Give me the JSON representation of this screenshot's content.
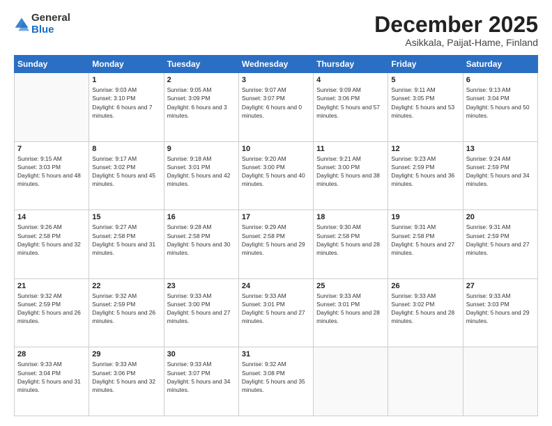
{
  "logo": {
    "general": "General",
    "blue": "Blue"
  },
  "header": {
    "month": "December 2025",
    "location": "Asikkala, Paijat-Hame, Finland"
  },
  "weekdays": [
    "Sunday",
    "Monday",
    "Tuesday",
    "Wednesday",
    "Thursday",
    "Friday",
    "Saturday"
  ],
  "weeks": [
    [
      {
        "day": "",
        "empty": true
      },
      {
        "day": "1",
        "sunrise": "Sunrise: 9:03 AM",
        "sunset": "Sunset: 3:10 PM",
        "daylight": "Daylight: 6 hours and 7 minutes."
      },
      {
        "day": "2",
        "sunrise": "Sunrise: 9:05 AM",
        "sunset": "Sunset: 3:09 PM",
        "daylight": "Daylight: 6 hours and 3 minutes."
      },
      {
        "day": "3",
        "sunrise": "Sunrise: 9:07 AM",
        "sunset": "Sunset: 3:07 PM",
        "daylight": "Daylight: 6 hours and 0 minutes."
      },
      {
        "day": "4",
        "sunrise": "Sunrise: 9:09 AM",
        "sunset": "Sunset: 3:06 PM",
        "daylight": "Daylight: 5 hours and 57 minutes."
      },
      {
        "day": "5",
        "sunrise": "Sunrise: 9:11 AM",
        "sunset": "Sunset: 3:05 PM",
        "daylight": "Daylight: 5 hours and 53 minutes."
      },
      {
        "day": "6",
        "sunrise": "Sunrise: 9:13 AM",
        "sunset": "Sunset: 3:04 PM",
        "daylight": "Daylight: 5 hours and 50 minutes."
      }
    ],
    [
      {
        "day": "7",
        "sunrise": "Sunrise: 9:15 AM",
        "sunset": "Sunset: 3:03 PM",
        "daylight": "Daylight: 5 hours and 48 minutes."
      },
      {
        "day": "8",
        "sunrise": "Sunrise: 9:17 AM",
        "sunset": "Sunset: 3:02 PM",
        "daylight": "Daylight: 5 hours and 45 minutes."
      },
      {
        "day": "9",
        "sunrise": "Sunrise: 9:18 AM",
        "sunset": "Sunset: 3:01 PM",
        "daylight": "Daylight: 5 hours and 42 minutes."
      },
      {
        "day": "10",
        "sunrise": "Sunrise: 9:20 AM",
        "sunset": "Sunset: 3:00 PM",
        "daylight": "Daylight: 5 hours and 40 minutes."
      },
      {
        "day": "11",
        "sunrise": "Sunrise: 9:21 AM",
        "sunset": "Sunset: 3:00 PM",
        "daylight": "Daylight: 5 hours and 38 minutes."
      },
      {
        "day": "12",
        "sunrise": "Sunrise: 9:23 AM",
        "sunset": "Sunset: 2:59 PM",
        "daylight": "Daylight: 5 hours and 36 minutes."
      },
      {
        "day": "13",
        "sunrise": "Sunrise: 9:24 AM",
        "sunset": "Sunset: 2:59 PM",
        "daylight": "Daylight: 5 hours and 34 minutes."
      }
    ],
    [
      {
        "day": "14",
        "sunrise": "Sunrise: 9:26 AM",
        "sunset": "Sunset: 2:58 PM",
        "daylight": "Daylight: 5 hours and 32 minutes."
      },
      {
        "day": "15",
        "sunrise": "Sunrise: 9:27 AM",
        "sunset": "Sunset: 2:58 PM",
        "daylight": "Daylight: 5 hours and 31 minutes."
      },
      {
        "day": "16",
        "sunrise": "Sunrise: 9:28 AM",
        "sunset": "Sunset: 2:58 PM",
        "daylight": "Daylight: 5 hours and 30 minutes."
      },
      {
        "day": "17",
        "sunrise": "Sunrise: 9:29 AM",
        "sunset": "Sunset: 2:58 PM",
        "daylight": "Daylight: 5 hours and 29 minutes."
      },
      {
        "day": "18",
        "sunrise": "Sunrise: 9:30 AM",
        "sunset": "Sunset: 2:58 PM",
        "daylight": "Daylight: 5 hours and 28 minutes."
      },
      {
        "day": "19",
        "sunrise": "Sunrise: 9:31 AM",
        "sunset": "Sunset: 2:58 PM",
        "daylight": "Daylight: 5 hours and 27 minutes."
      },
      {
        "day": "20",
        "sunrise": "Sunrise: 9:31 AM",
        "sunset": "Sunset: 2:59 PM",
        "daylight": "Daylight: 5 hours and 27 minutes."
      }
    ],
    [
      {
        "day": "21",
        "sunrise": "Sunrise: 9:32 AM",
        "sunset": "Sunset: 2:59 PM",
        "daylight": "Daylight: 5 hours and 26 minutes."
      },
      {
        "day": "22",
        "sunrise": "Sunrise: 9:32 AM",
        "sunset": "Sunset: 2:59 PM",
        "daylight": "Daylight: 5 hours and 26 minutes."
      },
      {
        "day": "23",
        "sunrise": "Sunrise: 9:33 AM",
        "sunset": "Sunset: 3:00 PM",
        "daylight": "Daylight: 5 hours and 27 minutes."
      },
      {
        "day": "24",
        "sunrise": "Sunrise: 9:33 AM",
        "sunset": "Sunset: 3:01 PM",
        "daylight": "Daylight: 5 hours and 27 minutes."
      },
      {
        "day": "25",
        "sunrise": "Sunrise: 9:33 AM",
        "sunset": "Sunset: 3:01 PM",
        "daylight": "Daylight: 5 hours and 28 minutes."
      },
      {
        "day": "26",
        "sunrise": "Sunrise: 9:33 AM",
        "sunset": "Sunset: 3:02 PM",
        "daylight": "Daylight: 5 hours and 28 minutes."
      },
      {
        "day": "27",
        "sunrise": "Sunrise: 9:33 AM",
        "sunset": "Sunset: 3:03 PM",
        "daylight": "Daylight: 5 hours and 29 minutes."
      }
    ],
    [
      {
        "day": "28",
        "sunrise": "Sunrise: 9:33 AM",
        "sunset": "Sunset: 3:04 PM",
        "daylight": "Daylight: 5 hours and 31 minutes."
      },
      {
        "day": "29",
        "sunrise": "Sunrise: 9:33 AM",
        "sunset": "Sunset: 3:06 PM",
        "daylight": "Daylight: 5 hours and 32 minutes."
      },
      {
        "day": "30",
        "sunrise": "Sunrise: 9:33 AM",
        "sunset": "Sunset: 3:07 PM",
        "daylight": "Daylight: 5 hours and 34 minutes."
      },
      {
        "day": "31",
        "sunrise": "Sunrise: 9:32 AM",
        "sunset": "Sunset: 3:08 PM",
        "daylight": "Daylight: 5 hours and 35 minutes."
      },
      {
        "day": "",
        "empty": true
      },
      {
        "day": "",
        "empty": true
      },
      {
        "day": "",
        "empty": true
      }
    ]
  ]
}
